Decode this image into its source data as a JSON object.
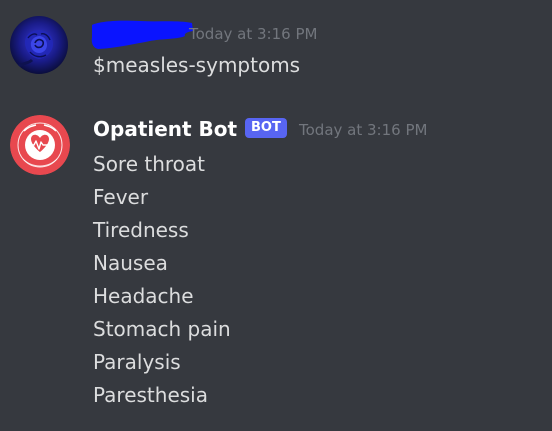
{
  "messages": {
    "user": {
      "timestamp": "Today at 3:16 PM",
      "content": "$measles-symptoms",
      "avatar_icon": "blue-rose-avatar",
      "username_redaction_color": "#0a14ff"
    },
    "bot": {
      "username": "Opatient Bot",
      "tag": "BOT",
      "timestamp": "Today at 3:16 PM",
      "avatar_icon": "opatient-logo-avatar",
      "lines": [
        "Sore throat",
        "Fever",
        "Tiredness",
        "Nausea",
        "Headache",
        "Stomach pain",
        "Paralysis",
        "Paresthesia"
      ]
    }
  },
  "colors": {
    "background": "#36393f",
    "message_text": "#dcddde",
    "timestamp_text": "#72767d",
    "username_text": "#ffffff",
    "bot_tag": "#5865f2",
    "logo_red": "#e8484f"
  }
}
